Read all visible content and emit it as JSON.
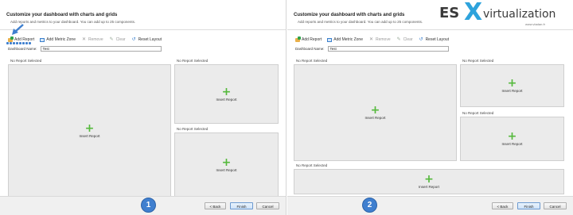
{
  "panels": [
    {
      "title": "Customize your dashboard with charts and grids",
      "subtitle": "Add reports and metrics to your dashboard. You can add up to 25 components.",
      "toolbar": {
        "add_report": "Add Report",
        "add_metric_zone": "Add Metric Zone",
        "remove": "Remove",
        "clear": "Clear",
        "reset_layout": "Reset Layout"
      },
      "dashboard_name_label": "Dashboard Name:",
      "dashboard_name_value": "Test",
      "zones": [
        {
          "label": "No Report Selected",
          "action": "Insert Report"
        },
        {
          "label": "No Report Selected",
          "action": "Insert Report"
        },
        {
          "label": "No Report Selected",
          "action": "Insert Report"
        }
      ],
      "step_number": "1",
      "buttons": {
        "back": "< Back",
        "finish": "Finish",
        "cancel": "Cancel"
      }
    },
    {
      "title": "Customize your dashboard with charts and grids",
      "subtitle": "Add reports and metrics to your dashboard. You can add up to 25 components.",
      "toolbar": {
        "add_report": "Add Report",
        "add_metric_zone": "Add Metric Zone",
        "remove": "Remove",
        "clear": "Clear",
        "reset_layout": "Reset Layout"
      },
      "dashboard_name_label": "Dashboard Name:",
      "dashboard_name_value": "Test",
      "zones": [
        {
          "label": "No Report Selected",
          "action": "Insert Report"
        },
        {
          "label": "No Report Selected",
          "action": "Insert Report"
        },
        {
          "label": "No Report Selected",
          "action": "Insert Report"
        },
        {
          "label": "No Report Selected",
          "action": "Insert Report"
        }
      ],
      "step_number": "2",
      "buttons": {
        "back": "< Back",
        "finish": "Finish",
        "cancel": "Cancel"
      }
    }
  ],
  "watermark": {
    "brand_es": "ES",
    "brand_x": "X",
    "brand_rest": "virtualization",
    "url": "www.vladan.fr"
  },
  "colors": {
    "accent": "#3f7fcf",
    "plus_green": "#55b93c",
    "zone_bg": "#ebebeb"
  }
}
